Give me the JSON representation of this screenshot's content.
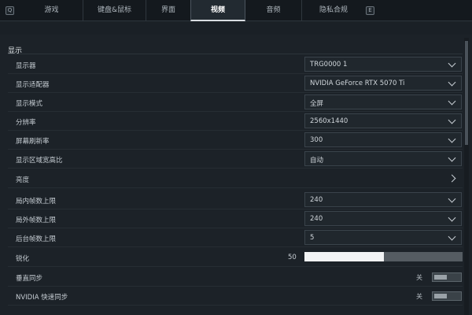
{
  "tabs": {
    "prev_key": "Q",
    "next_key": "E",
    "items": [
      "游戏",
      "键盘&鼠标",
      "界面",
      "视频",
      "音频",
      "隐私合规"
    ],
    "active": "视频"
  },
  "section": {
    "title": "显示"
  },
  "rows": {
    "monitor": {
      "label": "显示器",
      "value": "TRG0000 1"
    },
    "adapter": {
      "label": "显示适配器",
      "value": "NVIDIA GeForce RTX 5070 Ti"
    },
    "display_mode": {
      "label": "显示模式",
      "value": "全屏"
    },
    "resolution": {
      "label": "分辨率",
      "value": "2560x1440"
    },
    "refresh_rate": {
      "label": "屏幕刷新率",
      "value": "300"
    },
    "aspect_ratio": {
      "label": "显示区域宽高比",
      "value": "自动"
    },
    "brightness": {
      "label": "亮度"
    },
    "fps_in_match": {
      "label": "局内帧数上限",
      "value": "240"
    },
    "fps_out_match": {
      "label": "局外帧数上限",
      "value": "240"
    },
    "fps_background": {
      "label": "后台帧数上限",
      "value": "5"
    },
    "sharpen": {
      "label": "锐化",
      "value": "50",
      "fraction": 0.5
    },
    "vsync": {
      "label": "垂直同步",
      "state": "关"
    },
    "nvidia_fast_sync": {
      "label": "NVIDIA 快速同步",
      "state": "关"
    }
  }
}
